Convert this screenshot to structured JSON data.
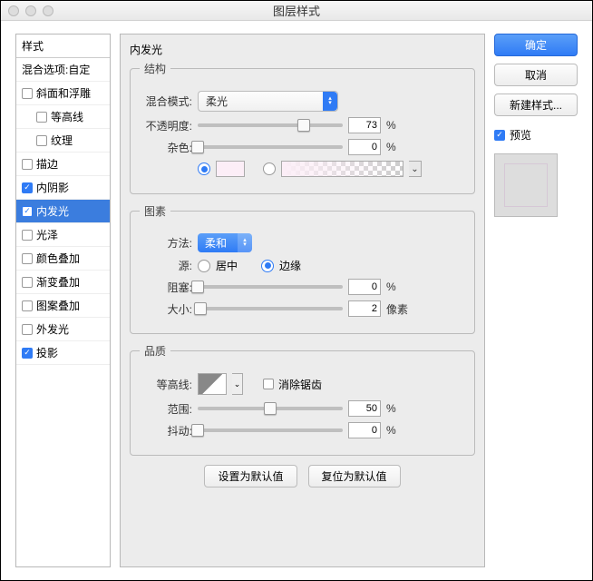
{
  "window": {
    "title": "图层样式"
  },
  "styles": {
    "header": "样式",
    "blend_options": "混合选项:自定",
    "items": [
      {
        "label": "斜面和浮雕",
        "checked": false,
        "indent": 0
      },
      {
        "label": "等高线",
        "checked": false,
        "indent": 1
      },
      {
        "label": "纹理",
        "checked": false,
        "indent": 1
      },
      {
        "label": "描边",
        "checked": false,
        "indent": 0
      },
      {
        "label": "内阴影",
        "checked": true,
        "indent": 0
      },
      {
        "label": "内发光",
        "checked": true,
        "indent": 0,
        "selected": true
      },
      {
        "label": "光泽",
        "checked": false,
        "indent": 0
      },
      {
        "label": "颜色叠加",
        "checked": false,
        "indent": 0
      },
      {
        "label": "渐变叠加",
        "checked": false,
        "indent": 0
      },
      {
        "label": "图案叠加",
        "checked": false,
        "indent": 0
      },
      {
        "label": "外发光",
        "checked": false,
        "indent": 0
      },
      {
        "label": "投影",
        "checked": true,
        "indent": 0
      }
    ]
  },
  "panel": {
    "title": "内发光",
    "structure": {
      "legend": "结构",
      "blend_mode_label": "混合模式:",
      "blend_mode_value": "柔光",
      "opacity_label": "不透明度:",
      "opacity_value": "73",
      "opacity_unit": "%",
      "noise_label": "杂色:",
      "noise_value": "0",
      "noise_unit": "%"
    },
    "elements": {
      "legend": "图素",
      "technique_label": "方法:",
      "technique_value": "柔和",
      "source_label": "源:",
      "source_center": "居中",
      "source_edge": "边缘",
      "choke_label": "阻塞:",
      "choke_value": "0",
      "choke_unit": "%",
      "size_label": "大小:",
      "size_value": "2",
      "size_unit": "像素"
    },
    "quality": {
      "legend": "品质",
      "contour_label": "等高线:",
      "antialias_label": "消除锯齿",
      "range_label": "范围:",
      "range_value": "50",
      "range_unit": "%",
      "jitter_label": "抖动:",
      "jitter_value": "0",
      "jitter_unit": "%"
    },
    "buttons": {
      "make_default": "设置为默认值",
      "reset_default": "复位为默认值"
    }
  },
  "side": {
    "ok": "确定",
    "cancel": "取消",
    "new_style": "新建样式...",
    "preview_label": "预览"
  }
}
